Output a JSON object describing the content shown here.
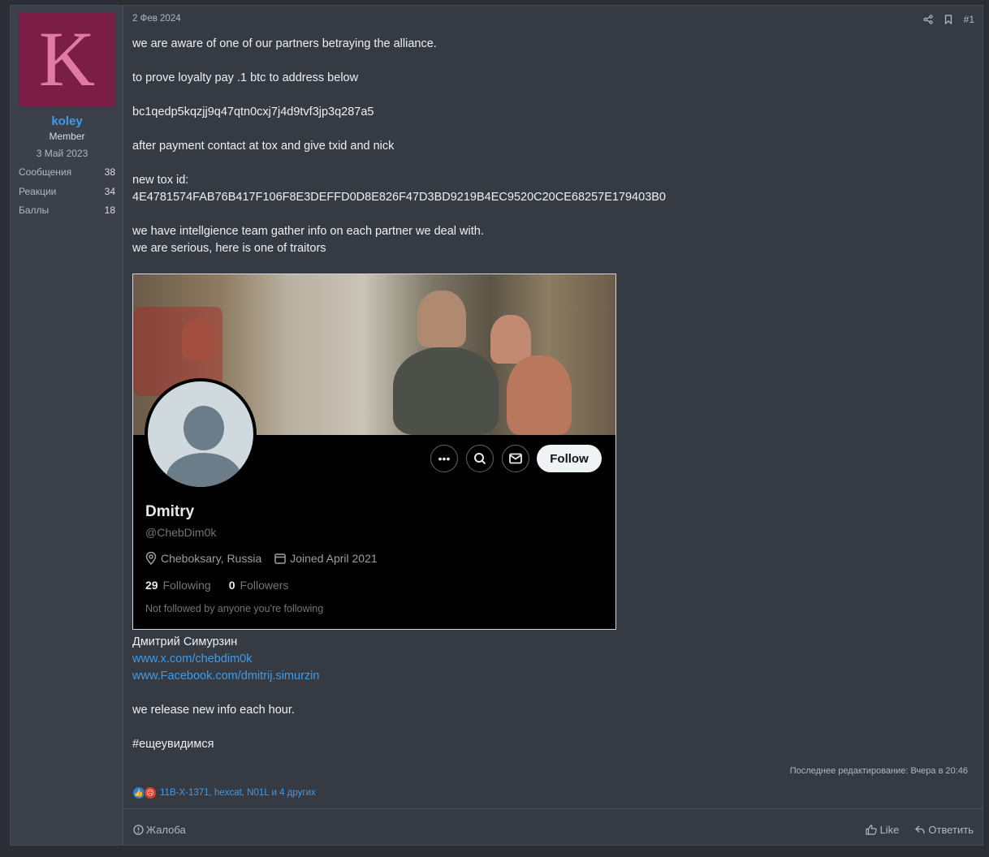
{
  "user": {
    "avatar_letter": "K",
    "name": "koley",
    "role": "Member",
    "joined": "3 Май 2023",
    "stats": [
      {
        "label": "Сообщения",
        "value": "38"
      },
      {
        "label": "Реакции",
        "value": "34"
      },
      {
        "label": "Баллы",
        "value": "18"
      }
    ]
  },
  "post": {
    "date": "2 Фев 2024",
    "number": "#1",
    "icons": [
      "share-icon",
      "bookmark-icon"
    ],
    "lines": {
      "l1": "we are aware of one of our partners betraying the alliance.",
      "l2": "to prove loyalty pay .1 btc to address below",
      "l3": "bc1qedp5kqzjj9q47qtn0cxj7j4d9tvf3jp3q287a5",
      "l4": "after payment contact at tox and give txid and nick",
      "l5": "new tox id:",
      "l6": "4E4781574FAB76B417F106F8E3DEFFD0D8E826F47D3BD9219B4EC9520C20CE68257E179403B0",
      "l7": "we have intellgience team gather info on each partner we deal with.",
      "l8": "we are serious, here is one of traitors"
    },
    "embed": {
      "name": "Dmitry",
      "handle": "@ChebDim0k",
      "location": "Cheboksary, Russia",
      "joined": "Joined April 2021",
      "following_count": "29",
      "following_label": "Following",
      "followers_count": "0",
      "followers_label": "Followers",
      "note": "Not followed by anyone you're following",
      "follow_button": "Follow"
    },
    "after": {
      "name_line": "Дмитрий Симурзин",
      "link1": "www.x.com/chebdim0k",
      "link2": "www.Facebook.com/dmitrij.simurzin",
      "release": "we release new info each hour.",
      "hashtag": "#ещеувидимся"
    },
    "edited": "Последнее редактирование: Вчера в 20:46",
    "reactions_text": "11B-X-1371, hexcat, N01L и 4 других",
    "footer": {
      "report": "Жалоба",
      "like": "Like",
      "reply": "Ответить"
    }
  }
}
